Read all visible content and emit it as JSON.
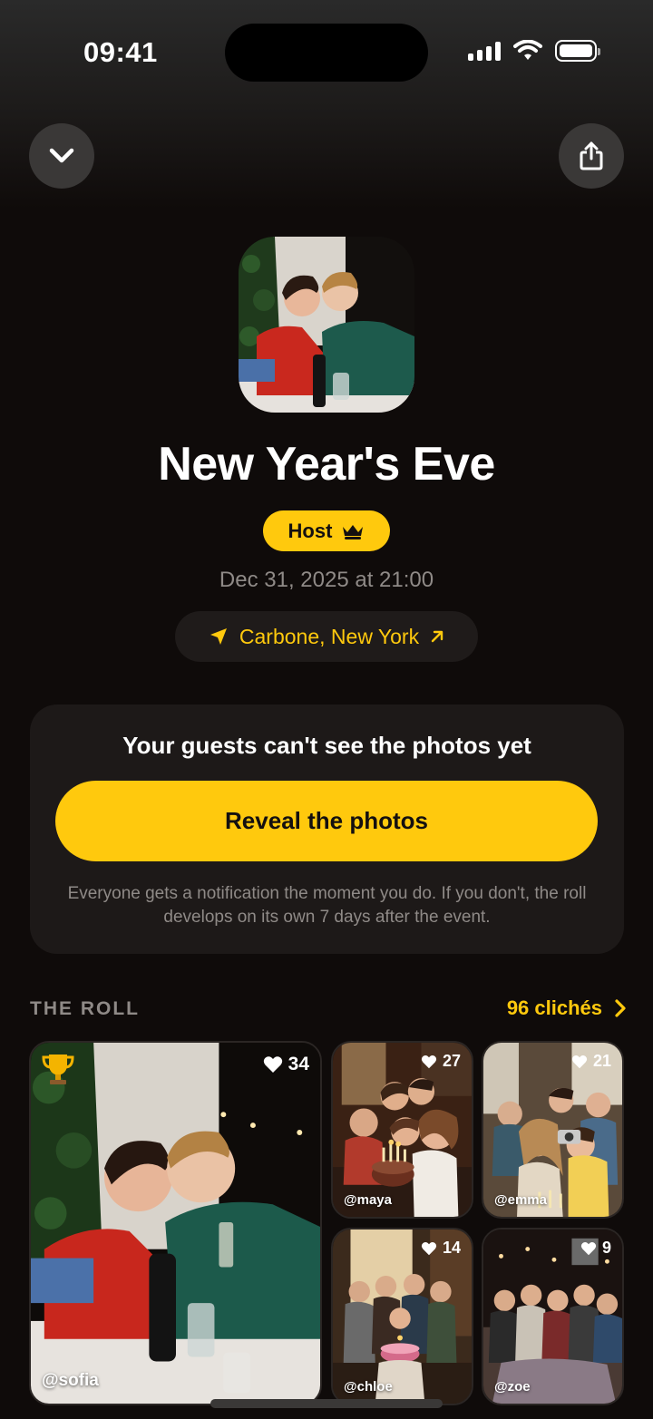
{
  "status_bar": {
    "time": "09:41"
  },
  "nav": {
    "collapse_icon": "chevron-down-icon",
    "share_icon": "share-icon"
  },
  "event": {
    "title": "New Year's Eve",
    "role_badge": "Host",
    "role_icon": "crown-icon",
    "date": "Dec 31, 2025 at 21:00",
    "location": "Carbone, New York",
    "location_icon": "location-arrow-icon",
    "external_icon": "arrow-up-right-icon"
  },
  "reveal": {
    "title": "Your guests can't see the photos yet",
    "button_label": "Reveal the photos",
    "description": "Everyone gets a notification the moment you do. If you don't, the roll develops on its own 7 days after the event."
  },
  "roll": {
    "heading": "THE ROLL",
    "count_label": "96 clichés",
    "photos": [
      {
        "handle": "@sofia",
        "likes": "34",
        "top_icon": "trophy-icon"
      },
      {
        "handle": "@maya",
        "likes": "27"
      },
      {
        "handle": "@emma",
        "likes": "21"
      },
      {
        "handle": "@chloe",
        "likes": "14"
      },
      {
        "handle": "@zoe",
        "likes": "9"
      }
    ]
  },
  "colors": {
    "accent": "#ffc90d",
    "background": "#0f0b0a",
    "card": "#1d1918",
    "muted_text": "#8f8a87"
  }
}
